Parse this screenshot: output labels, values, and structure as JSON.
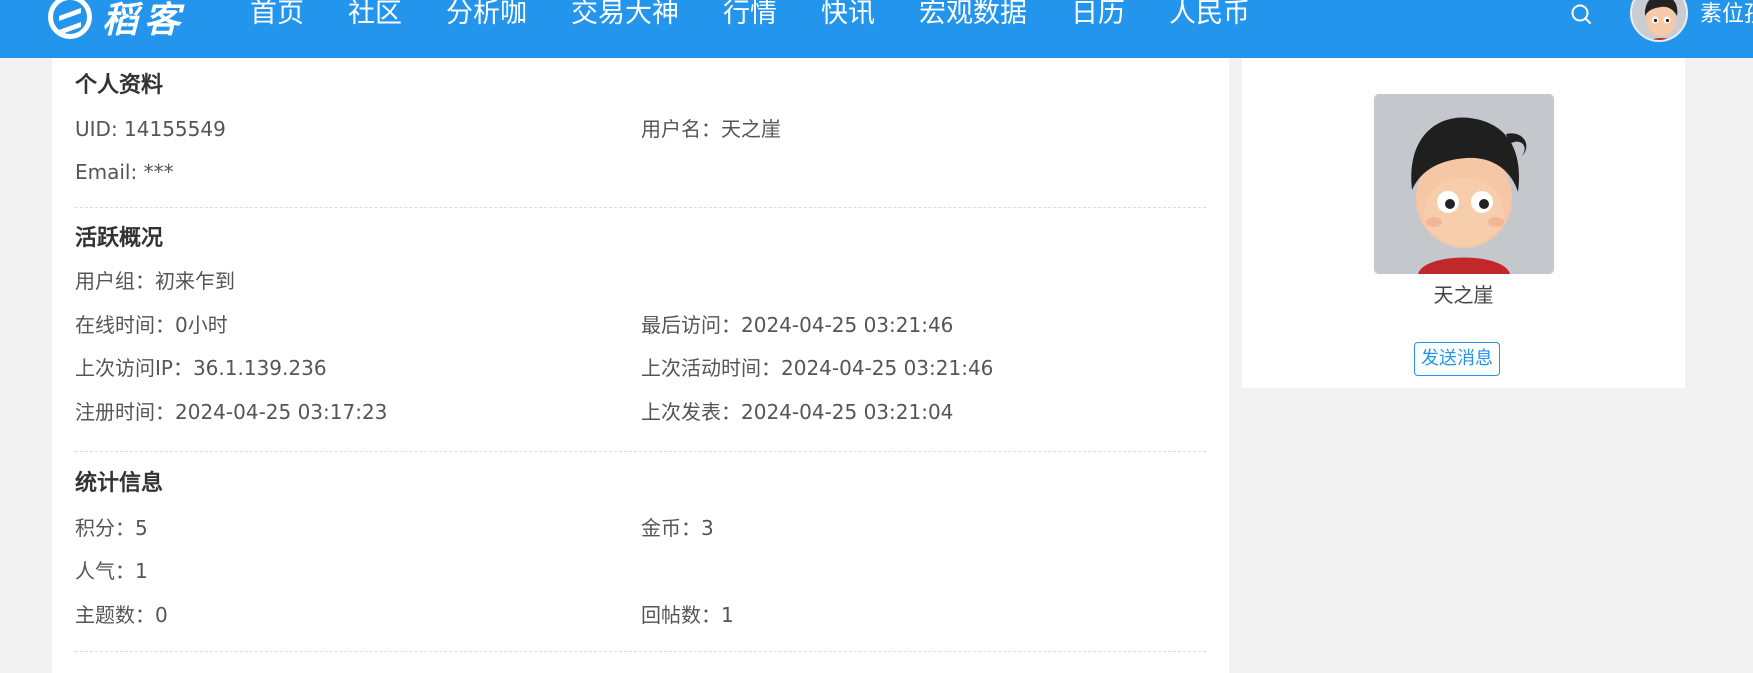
{
  "header": {
    "logo_text": "稻客",
    "nav": [
      {
        "label": "首页"
      },
      {
        "label": "社区"
      },
      {
        "label": "分析咖"
      },
      {
        "label": "交易大神"
      },
      {
        "label": "行情"
      },
      {
        "label": "快讯"
      },
      {
        "label": "宏观数据"
      },
      {
        "label": "日历"
      },
      {
        "label": "人民币"
      }
    ],
    "user_name": "素位孩",
    "search_icon": "search-icon",
    "accent_color": "#2395ec"
  },
  "profile": {
    "title": "个人资料",
    "uid": "UID: 14155549",
    "username": "用户名：天之崖",
    "email": "Email: ***"
  },
  "activity": {
    "title": "活跃概况",
    "group": "用户组：初来乍到",
    "online_time": "在线时间：0小时",
    "last_visit": "最后访问：2024-04-25 03:21:46",
    "last_ip": "上次访问IP：36.1.139.236",
    "last_active": "上次活动时间：2024-04-25 03:21:46",
    "register_time": "注册时间：2024-04-25 03:17:23",
    "last_post": "上次发表：2024-04-25 03:21:04"
  },
  "stats": {
    "title": "统计信息",
    "points": "积分：5",
    "coins": "金币：3",
    "popularity": "人气：1",
    "topics": "主题数：0",
    "replies": "回帖数：1"
  },
  "sidebar": {
    "username": "天之崖",
    "send_message": "发送消息"
  }
}
